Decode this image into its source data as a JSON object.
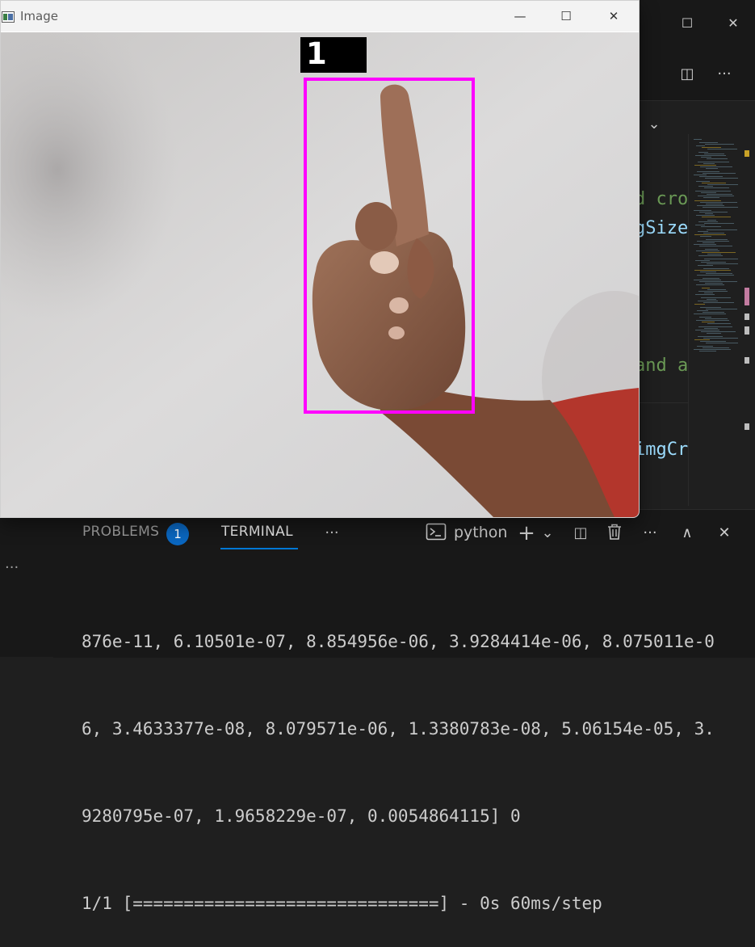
{
  "vscode": {
    "window_controls": {
      "restore_glyph": "☐",
      "close_glyph": "✕"
    },
    "editor_actions": {
      "dropdown_glyph": "⌄",
      "split_glyph": "◫",
      "more_glyph": "···"
    },
    "code_fragments": [
      {
        "text": "d cro",
        "color": "#6a9955"
      },
      {
        "text": "gSize",
        "color": "#9cdcfe"
      },
      {
        "text": "and a",
        "color": "#6a9955"
      },
      {
        "text": "imgCr",
        "color": "#9cdcfe"
      }
    ]
  },
  "panel": {
    "tabs": {
      "problems": "PROBLEMS",
      "problems_count": "1",
      "terminal": "TERMINAL",
      "more": "···"
    },
    "terminal_name": "python",
    "actions": {
      "add": "+",
      "add_dropdown": "⌄",
      "split": "◫",
      "trash": "🗑",
      "more": "···",
      "maximize": "∧",
      "close": "✕"
    },
    "left_strip_more": "···",
    "terminal_lines": [
      "876e-11, 6.10501e-07, 8.854956e-06, 3.9284414e-06, 8.075011e-0",
      "6, 3.4633377e-08, 8.079571e-06, 1.3380783e-08, 5.06154e-05, 3.",
      "9280795e-07, 1.9658229e-07, 0.0054864115] 0",
      "1/1 [==============================] - 0s 60ms/step"
    ]
  },
  "image_window": {
    "title": "Image",
    "controls": {
      "minimize": "—",
      "maximize": "☐",
      "close": "✕"
    },
    "prediction_label": "1",
    "box_color": "#ff00ff"
  }
}
